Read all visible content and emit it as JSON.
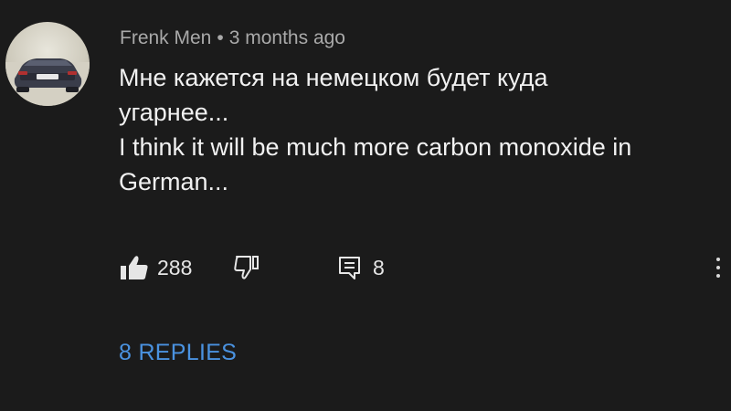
{
  "comment": {
    "author": "Frenk Men",
    "separator": "•",
    "time": "3 months ago",
    "lines": [
      "Мне кажется на немецком будет куда",
      "угарнее...",
      "I think it will be much more carbon monoxide in",
      "German..."
    ],
    "likes": "288",
    "reply_count": "8",
    "replies_link": "8 REPLIES"
  },
  "icons": {
    "avatar": "avatar-car-photo",
    "like": "thumbs-up-icon",
    "dislike": "thumbs-down-icon",
    "reply": "comment-reply-icon",
    "more": "more-vertical-icon"
  },
  "colors": {
    "background": "#1b1b1b",
    "text": "#f1f1f1",
    "meta": "#a9a9a9",
    "link": "#4a92e0"
  }
}
